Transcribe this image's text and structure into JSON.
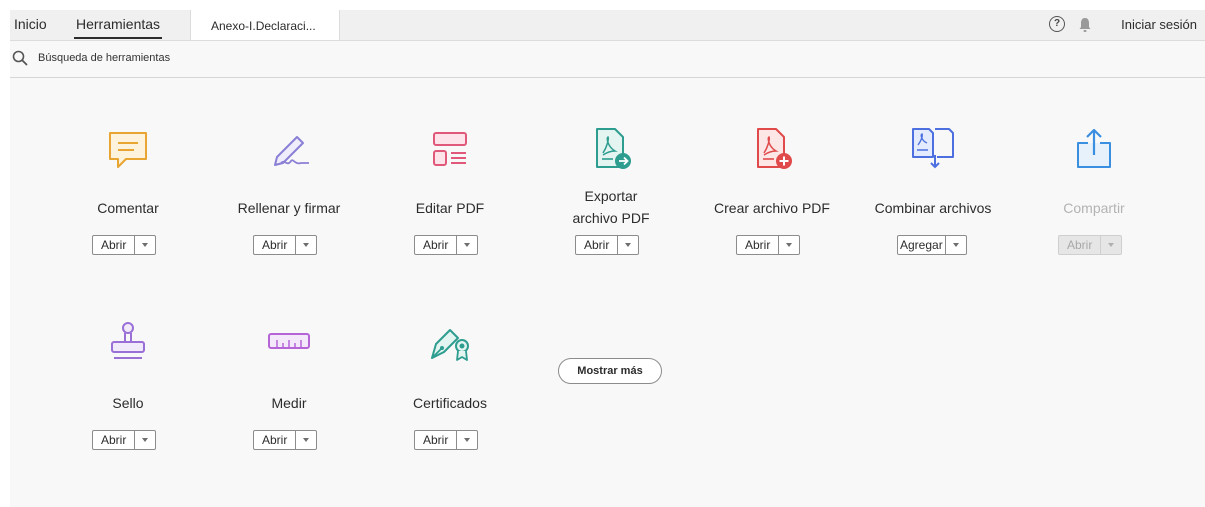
{
  "nav": {
    "home": "Inicio",
    "tools": "Herramientas",
    "document_tab": "Anexo-I.Declaraci...",
    "signin": "Iniciar sesión"
  },
  "search": {
    "placeholder": "Búsqueda de herramientas"
  },
  "tools": [
    {
      "label": "Comentar",
      "button": "Abrir",
      "icon": "comment-icon",
      "color": "#e8a531"
    },
    {
      "label": "Rellenar y firmar",
      "button": "Abrir",
      "icon": "fill-sign-icon",
      "color": "#8a7fd6"
    },
    {
      "label": "Editar PDF",
      "button": "Abrir",
      "icon": "edit-pdf-icon",
      "color": "#e0587a"
    },
    {
      "label": "Exportar archivo PDF",
      "button": "Abrir",
      "icon": "export-pdf-icon",
      "color": "#2d9d8f"
    },
    {
      "label": "Crear archivo PDF",
      "button": "Abrir",
      "icon": "create-pdf-icon",
      "color": "#e04a4a"
    },
    {
      "label": "Combinar archivos",
      "button": "Agregar",
      "icon": "combine-files-icon",
      "color": "#4d6fe0"
    },
    {
      "label": "Compartir",
      "button": "Abrir",
      "icon": "share-icon",
      "color": "#3a8fe0",
      "disabled": true
    },
    {
      "label": "Sello",
      "button": "Abrir",
      "icon": "stamp-icon",
      "color": "#9a6fd6"
    },
    {
      "label": "Medir",
      "button": "Abrir",
      "icon": "measure-icon",
      "color": "#b565d6"
    },
    {
      "label": "Certificados",
      "button": "Abrir",
      "icon": "certificate-icon",
      "color": "#2d9d8f"
    }
  ],
  "show_more": "Mostrar más"
}
